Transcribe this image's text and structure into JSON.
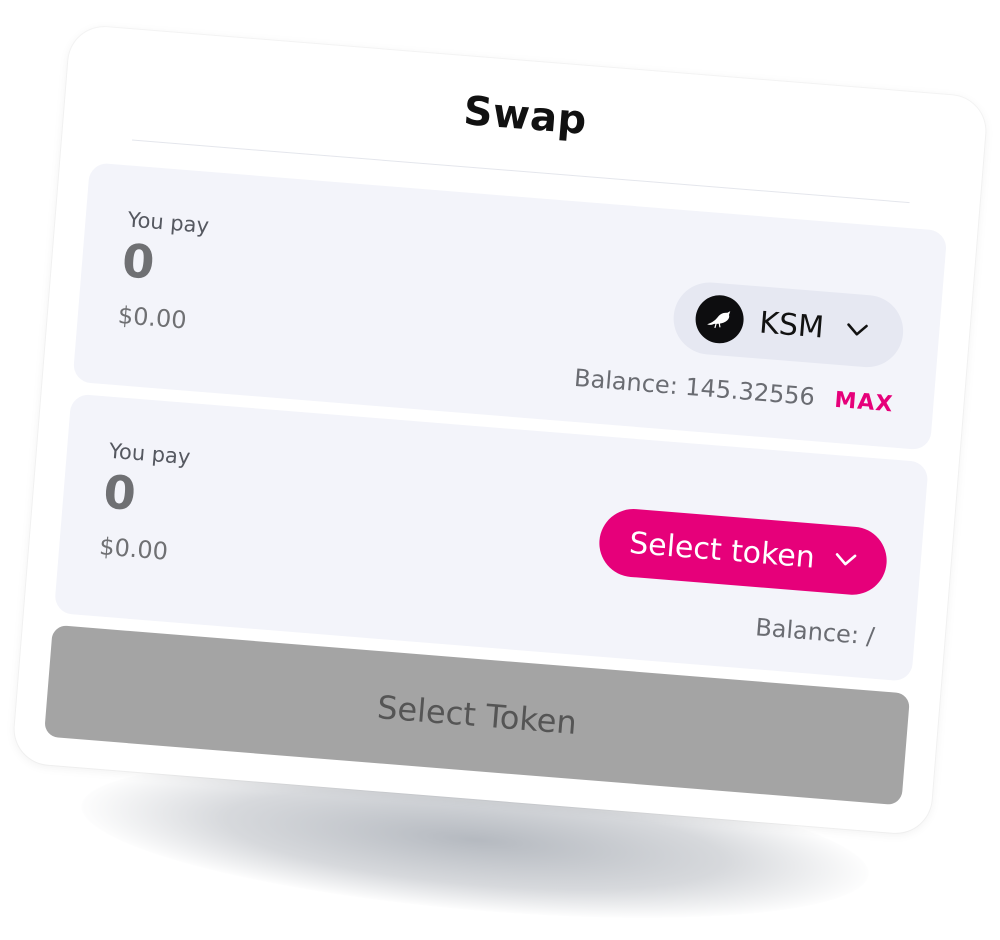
{
  "swap": {
    "title": "Swap",
    "pay": {
      "label": "You pay",
      "amount": "0",
      "fiat": "$0.00",
      "token": {
        "symbol": "KSM",
        "icon": "kusama-bird-icon"
      },
      "balance": "Balance: 145.32556",
      "max_label": "MAX"
    },
    "receive": {
      "label": "You pay",
      "amount": "0",
      "fiat": "$0.00",
      "select_label": "Select token",
      "balance": "Balance: /"
    },
    "cta_label": "Select Token"
  },
  "colors": {
    "accent": "#e6007a",
    "panel": "#f3f4fa",
    "pill": "#e6e8f2",
    "cta_disabled": "#a4a4a4"
  }
}
